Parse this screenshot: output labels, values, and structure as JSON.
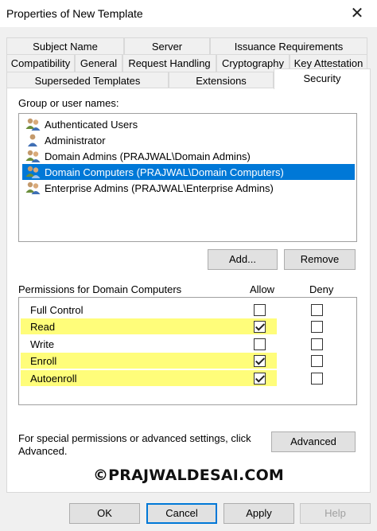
{
  "window": {
    "title": "Properties of New Template"
  },
  "tabs": {
    "row1": [
      "Subject Name",
      "Server",
      "Issuance Requirements"
    ],
    "row2": [
      "Compatibility",
      "General",
      "Request Handling",
      "Cryptography",
      "Key Attestation"
    ],
    "row3": [
      "Superseded Templates",
      "Extensions",
      "Security"
    ],
    "active": "Security"
  },
  "security": {
    "group_label": "Group or user names:",
    "users": [
      {
        "name": "Authenticated Users",
        "icon": "group-users-icon",
        "selected": false
      },
      {
        "name": "Administrator",
        "icon": "user-icon",
        "selected": false
      },
      {
        "name": "Domain Admins (PRAJWAL\\Domain Admins)",
        "icon": "group-users-icon",
        "selected": false
      },
      {
        "name": "Domain Computers (PRAJWAL\\Domain Computers)",
        "icon": "group-users-icon",
        "selected": true
      },
      {
        "name": "Enterprise Admins (PRAJWAL\\Enterprise Admins)",
        "icon": "group-users-icon",
        "selected": false
      }
    ],
    "add_label": "Add...",
    "remove_label": "Remove",
    "permissions_label": "Permissions for Domain Computers",
    "allow_header": "Allow",
    "deny_header": "Deny",
    "permissions": [
      {
        "name": "Full Control",
        "allow": false,
        "deny": false,
        "highlighted": false
      },
      {
        "name": "Read",
        "allow": true,
        "deny": false,
        "highlighted": true
      },
      {
        "name": "Write",
        "allow": false,
        "deny": false,
        "highlighted": false
      },
      {
        "name": "Enroll",
        "allow": true,
        "deny": false,
        "highlighted": true
      },
      {
        "name": "Autoenroll",
        "allow": true,
        "deny": false,
        "highlighted": true
      }
    ],
    "advanced_text_line1": "For special permissions or advanced settings, click",
    "advanced_text_line2": "Advanced.",
    "advanced_label": "Advanced"
  },
  "watermark": "©PRAJWALDESAI.COM",
  "footer": {
    "ok_label": "OK",
    "cancel_label": "Cancel",
    "apply_label": "Apply",
    "help_label": "Help"
  },
  "colors": {
    "selection": "#0078d7",
    "highlight": "#fffd7a"
  }
}
